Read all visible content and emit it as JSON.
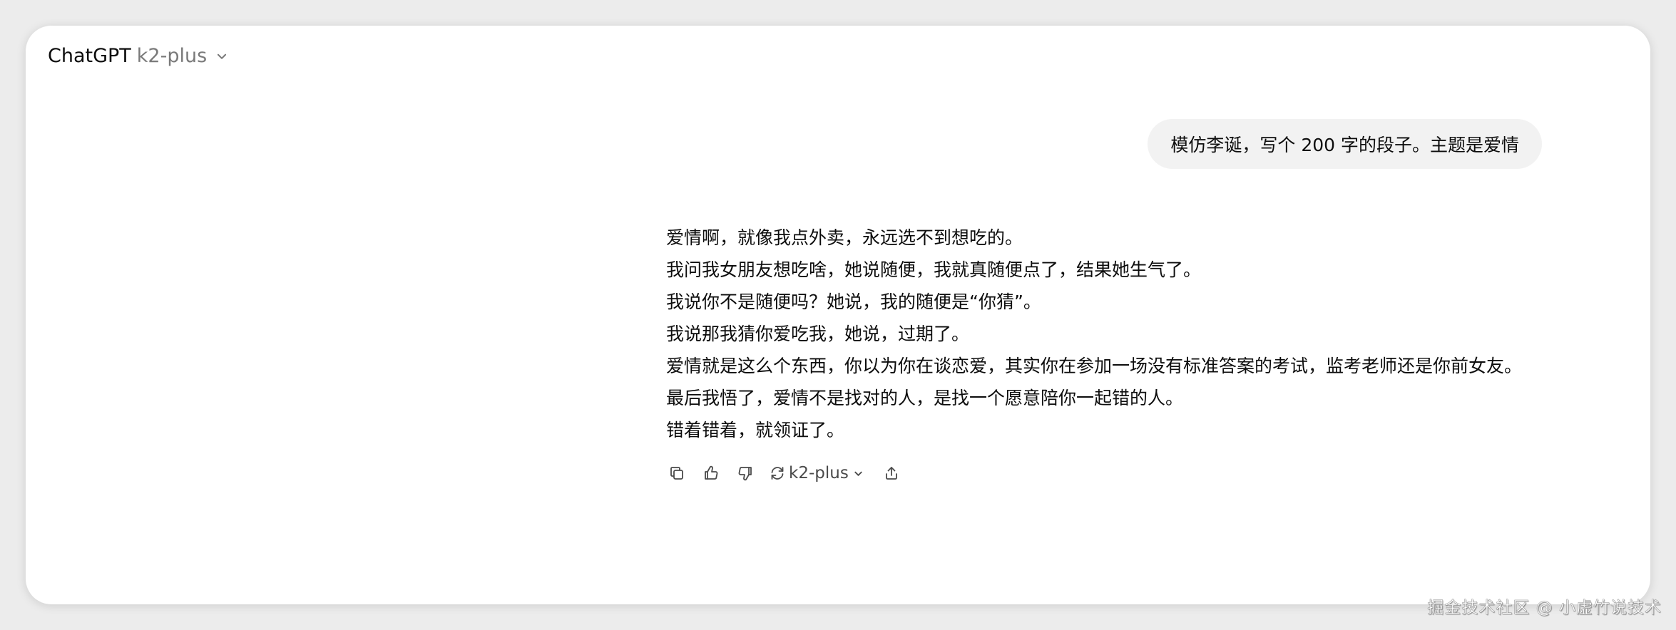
{
  "header": {
    "app_name": "ChatGPT",
    "model_name": "k2-plus"
  },
  "conversation": {
    "user_message": "模仿李诞，写个 200 字的段子。主题是爱情",
    "assistant_lines": [
      "爱情啊，就像我点外卖，永远选不到想吃的。",
      "我问我女朋友想吃啥，她说随便，我就真随便点了，结果她生气了。",
      "我说你不是随便吗？她说，我的随便是“你猜”。",
      "我说那我猜你爱吃我，她说，过期了。",
      "爱情就是这么个东西，你以为你在谈恋爱，其实你在参加一场没有标准答案的考试，监考老师还是你前女友。",
      "最后我悟了，爱情不是找对的人，是找一个愿意陪你一起错的人。",
      "错着错着，就领证了。"
    ]
  },
  "actions": {
    "regenerate_model": "k2-plus",
    "icons": [
      "copy-icon",
      "thumbs-up-icon",
      "thumbs-down-icon",
      "regenerate-icon",
      "share-icon"
    ]
  },
  "watermark": "掘金技术社区 @ 小虚竹说技术",
  "colors": {
    "background": "#ececec",
    "window": "#ffffff",
    "user_bubble": "#f2f2f2",
    "text": "#0d0d0d",
    "muted": "#7a7a7a"
  }
}
